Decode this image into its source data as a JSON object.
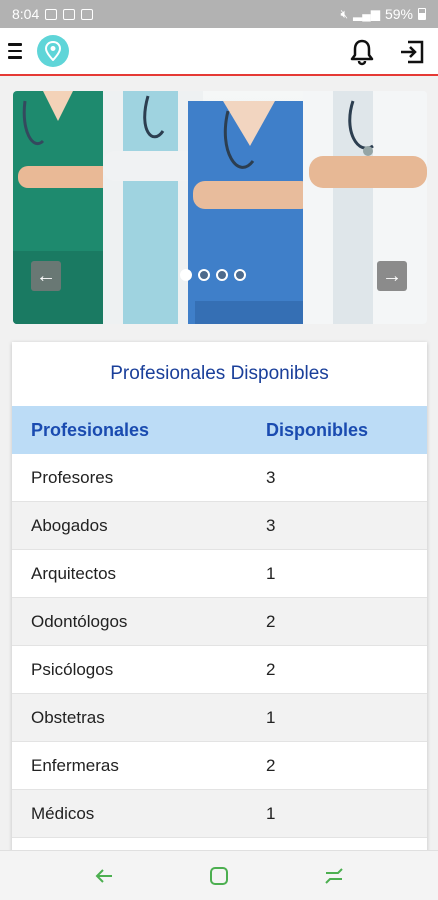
{
  "status_bar": {
    "time": "8:04",
    "battery": "59%",
    "notification_icons": [
      "image-icon",
      "download-icon",
      "mail-icon"
    ],
    "right_icons": [
      "mute-icon",
      "signal-icon",
      "battery-icon"
    ]
  },
  "app_bar": {
    "icons": [
      "menu-icon",
      "location-pin-icon",
      "bell-icon",
      "login-icon"
    ],
    "accent_color": "#e53935",
    "logo_color": "#5fd5d8"
  },
  "carousel": {
    "slide_count": 4,
    "active_index": 0,
    "icons": [
      "arrow-left-icon",
      "arrow-right-icon"
    ]
  },
  "card": {
    "title": "Profesionales Disponibles",
    "columns": [
      "Profesionales",
      "Disponibles"
    ],
    "header_color": "#bcdcf6",
    "title_color": "#1a3f9a",
    "rows": [
      {
        "name": "Profesores",
        "count": "3"
      },
      {
        "name": "Abogados",
        "count": "3"
      },
      {
        "name": "Arquitectos",
        "count": "1"
      },
      {
        "name": "Odontólogos",
        "count": "2"
      },
      {
        "name": "Psicólogos",
        "count": "2"
      },
      {
        "name": "Obstetras",
        "count": "1"
      },
      {
        "name": "Enfermeras",
        "count": "2"
      },
      {
        "name": "Médicos",
        "count": "1"
      }
    ]
  },
  "nav_bar": {
    "icons": [
      "back-icon",
      "home-icon",
      "recents-icon"
    ],
    "icon_color": "#4caf50"
  }
}
